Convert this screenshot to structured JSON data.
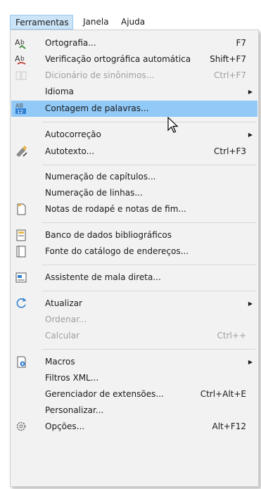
{
  "menubar": {
    "items": [
      {
        "label": "Ferramentas"
      },
      {
        "label": "Janela"
      },
      {
        "label": "Ajuda"
      }
    ]
  },
  "menu": {
    "items": [
      {
        "label": "Ortografia...",
        "shortcut": "F7",
        "icon": "spelling-icon"
      },
      {
        "label": "Verificação ortográfica automática",
        "shortcut": "Shift+F7",
        "icon": "auto-spellcheck-icon"
      },
      {
        "label": "Dicionário de sinônimos...",
        "shortcut": "Ctrl+F7",
        "icon": "thesaurus-icon",
        "disabled": true
      },
      {
        "label": "Idioma",
        "submenu": true
      },
      {
        "label": "Contagem de palavras...",
        "icon": "word-count-icon",
        "highlighted": true
      },
      {
        "label": "Autocorreção",
        "submenu": true
      },
      {
        "label": "Autotexto...",
        "shortcut": "Ctrl+F3",
        "icon": "autotext-icon"
      },
      {
        "label": "Numeração de capítulos..."
      },
      {
        "label": "Numeração de linhas..."
      },
      {
        "label": "Notas de rodapé e notas de fim...",
        "icon": "footnote-icon"
      },
      {
        "label": "Banco de dados bibliográficos",
        "icon": "bibliography-icon"
      },
      {
        "label": "Fonte do catálogo de endereços...",
        "icon": "address-book-icon"
      },
      {
        "label": "Assistente de mala direta...",
        "icon": "mail-merge-icon"
      },
      {
        "label": "Atualizar",
        "icon": "update-icon",
        "submenu": true
      },
      {
        "label": "Ordenar...",
        "disabled": true
      },
      {
        "label": "Calcular",
        "shortcut": "Ctrl++",
        "disabled": true
      },
      {
        "label": "Macros",
        "icon": "macro-icon",
        "submenu": true
      },
      {
        "label": "Filtros XML..."
      },
      {
        "label": "Gerenciador de extensões...",
        "shortcut": "Ctrl+Alt+E"
      },
      {
        "label": "Personalizar..."
      },
      {
        "label": "Opções...",
        "shortcut": "Alt+F12",
        "icon": "gear-icon"
      }
    ]
  },
  "colors": {
    "highlight": "#91c9f7",
    "menu_bg": "#f2f2f2",
    "menubar_active": "#cce4f7",
    "disabled_text": "#9e9e9e"
  }
}
